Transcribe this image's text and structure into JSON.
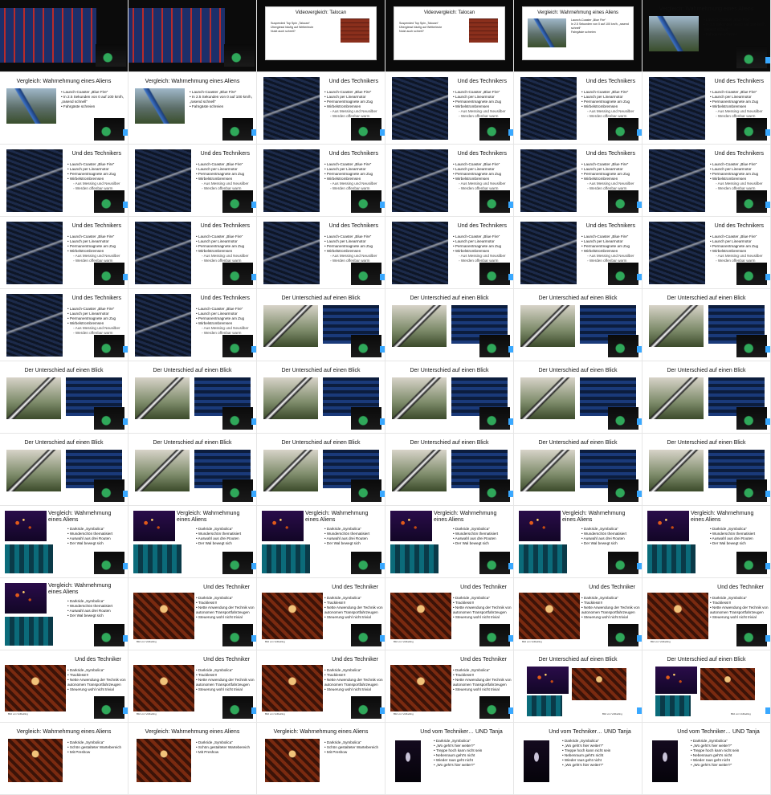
{
  "view": {
    "layout": "slide-sorter",
    "columns": 6,
    "rows": 11
  },
  "slides": [
    {
      "template": "photo-trains",
      "dark": true
    },
    {
      "template": "photo-trains",
      "dark": true
    },
    {
      "template": "video-talocan",
      "title": "Videovergleich: Talocan",
      "bullets": [
        "Suspended Top Spin „Talocan“",
        "Übergiesst häufig auf Wetterleute",
        "Nutzt auch schreit?"
      ]
    },
    {
      "template": "video-talocan",
      "title": "Videovergleich: Talocan",
      "bullets": [
        "Suspended Top Spin „Talocan“",
        "Übergiesst häufig auf Wetterleute",
        "Nutzt auch schreit?"
      ]
    },
    {
      "template": "vergleich-panel",
      "title": "Vergleich: Wahrnehmung eines Aliens",
      "bullets": [
        "Launch-Coaster „Blue Fire“",
        "In 2.5 Sekunden von 0 auf 100 km/h, „rasend schnell“",
        "Fahrgäste schreien"
      ]
    },
    {
      "template": "vergleich-coaster",
      "dark": true,
      "title": "Vergleich: Wahrnehmung eines Aliens",
      "bullets": [
        "Launch-Coaster „Blue Fire“",
        "In 2.5 Sekunden von 0 auf 100 km/h, „rasend schnell“",
        "Fahrgäste schreien"
      ]
    },
    {
      "template": "vergleich-coaster",
      "title": "Vergleich: Wahrnehmung eines Aliens",
      "bullets": [
        "Launch-Coaster „Blue Fire“",
        "In 2.5 Sekunden von 0 auf 100 km/h, „rasend schnell“",
        "Fahrgäste schreien"
      ]
    },
    {
      "template": "vergleich-coaster",
      "title": "Vergleich: Wahrnehmung eines Aliens",
      "bullets": [
        "Launch-Coaster „Blue Fire“",
        "In 2.5 Sekunden von 0 auf 100 km/h, „rasend schnell“",
        "Fahrgäste schreien"
      ]
    },
    {
      "template": "techniker",
      "title": "Und des Technikers",
      "bullets": [
        "Launch-Coaster „Blue Fire“",
        "Launch per Linearmotor",
        "Permanentmagnete am Zug",
        "Wirbelstrombremsen"
      ],
      "subs": [
        "Aus Messing und Neusilber",
        "Werden offenbar warm"
      ]
    },
    {
      "template": "techniker",
      "title": "Und des Technikers",
      "bullets": [
        "Launch-Coaster „Blue Fire“",
        "Launch per Linearmotor",
        "Permanentmagnete am Zug",
        "Wirbelstrombremsen"
      ],
      "subs": [
        "Aus Messing und Neusilber",
        "Werden offenbar warm"
      ]
    },
    {
      "template": "techniker",
      "title": "Und des Technikers",
      "bullets": [
        "Launch-Coaster „Blue Fire“",
        "Launch per Linearmotor",
        "Permanentmagnete am Zug",
        "Wirbelstrombremsen"
      ],
      "subs": [
        "Aus Messing und Neusilber",
        "Werden offenbar warm"
      ]
    },
    {
      "template": "techniker",
      "title": "Und des Technikers",
      "bullets": [
        "Launch-Coaster „Blue Fire“",
        "Launch per Linearmotor",
        "Permanentmagnete am Zug",
        "Wirbelstrombremsen"
      ],
      "subs": [
        "Aus Messing und Neusilber",
        "Werden offenbar warm"
      ]
    },
    {
      "template": "techniker",
      "title": "Und des Technikers",
      "bullets": [
        "Launch-Coaster „Blue Fire“",
        "Launch per Linearmotor",
        "Permanentmagnete am Zug",
        "Wirbelstrombremsen"
      ],
      "subs": [
        "Aus Messing und Neusilber",
        "Werden offenbar warm"
      ]
    },
    {
      "template": "techniker",
      "title": "Und des Technikers",
      "bullets": [
        "Launch-Coaster „Blue Fire“",
        "Launch per Linearmotor",
        "Permanentmagnete am Zug",
        "Wirbelstrombremsen"
      ],
      "subs": [
        "Aus Messing und Neusilber",
        "Werden offenbar warm"
      ]
    },
    {
      "template": "techniker",
      "title": "Und des Technikers",
      "bullets": [
        "Launch-Coaster „Blue Fire“",
        "Launch per Linearmotor",
        "Permanentmagnete am Zug",
        "Wirbelstrombremsen"
      ],
      "subs": [
        "Aus Messing und Neusilber",
        "Werden offenbar warm"
      ]
    },
    {
      "template": "techniker",
      "title": "Und des Technikers",
      "bullets": [
        "Launch-Coaster „Blue Fire“",
        "Launch per Linearmotor",
        "Permanentmagnete am Zug",
        "Wirbelstrombremsen"
      ],
      "subs": [
        "Aus Messing und Neusilber",
        "Werden offenbar warm"
      ]
    },
    {
      "template": "techniker",
      "title": "Und des Technikers",
      "bullets": [
        "Launch-Coaster „Blue Fire“",
        "Launch per Linearmotor",
        "Permanentmagnete am Zug",
        "Wirbelstrombremsen"
      ],
      "subs": [
        "Aus Messing und Neusilber",
        "Werden offenbar warm"
      ]
    },
    {
      "template": "techniker",
      "title": "Und des Technikers",
      "bullets": [
        "Launch-Coaster „Blue Fire“",
        "Launch per Linearmotor",
        "Permanentmagnete am Zug",
        "Wirbelstrombremsen"
      ],
      "subs": [
        "Aus Messing und Neusilber",
        "Werden offenbar warm"
      ]
    },
    {
      "template": "techniker",
      "title": "Und des Technikers",
      "bullets": [
        "Launch-Coaster „Blue Fire“",
        "Launch per Linearmotor",
        "Permanentmagnete am Zug",
        "Wirbelstrombremsen"
      ],
      "subs": [
        "Aus Messing und Neusilber",
        "Werden offenbar warm"
      ]
    },
    {
      "template": "techniker",
      "title": "Und des Technikers",
      "bullets": [
        "Launch-Coaster „Blue Fire“",
        "Launch per Linearmotor",
        "Permanentmagnete am Zug",
        "Wirbelstrombremsen"
      ],
      "subs": [
        "Aus Messing und Neusilber",
        "Werden offenbar warm"
      ]
    },
    {
      "template": "techniker",
      "title": "Und des Technikers",
      "bullets": [
        "Launch-Coaster „Blue Fire“",
        "Launch per Linearmotor",
        "Permanentmagnete am Zug",
        "Wirbelstrombremsen"
      ],
      "subs": [
        "Aus Messing und Neusilber",
        "Werden offenbar warm"
      ]
    },
    {
      "template": "techniker",
      "title": "Und des Technikers",
      "bullets": [
        "Launch-Coaster „Blue Fire“",
        "Launch per Linearmotor",
        "Permanentmagnete am Zug",
        "Wirbelstrombremsen"
      ],
      "subs": [
        "Aus Messing und Neusilber",
        "Werden offenbar warm"
      ]
    },
    {
      "template": "techniker",
      "title": "Und des Technikers",
      "bullets": [
        "Launch-Coaster „Blue Fire“",
        "Launch per Linearmotor",
        "Permanentmagnete am Zug",
        "Wirbelstrombremsen"
      ],
      "subs": [
        "Aus Messing und Neusilber",
        "Werden offenbar warm"
      ]
    },
    {
      "template": "techniker",
      "title": "Und des Technikers",
      "bullets": [
        "Launch-Coaster „Blue Fire“",
        "Launch per Linearmotor",
        "Permanentmagnete am Zug",
        "Wirbelstrombremsen"
      ],
      "subs": [
        "Aus Messing und Neusilber",
        "Werden offenbar warm"
      ]
    },
    {
      "template": "techniker",
      "title": "Und des Technikers",
      "bullets": [
        "Launch-Coaster „Blue Fire“",
        "Launch per Linearmotor",
        "Permanentmagnete am Zug",
        "Wirbelstrombremsen"
      ],
      "subs": [
        "Aus Messing und Neusilber",
        "Werden offenbar warm"
      ]
    },
    {
      "template": "techniker",
      "title": "Und des Technikers",
      "bullets": [
        "Launch-Coaster „Blue Fire“",
        "Launch per Linearmotor",
        "Permanentmagnete am Zug",
        "Wirbelstrombremsen"
      ],
      "subs": [
        "Aus Messing und Neusilber",
        "Werden offenbar warm"
      ]
    },
    {
      "template": "unterschied",
      "title": "Der Unterschied auf einen Blick"
    },
    {
      "template": "unterschied",
      "title": "Der Unterschied auf einen Blick"
    },
    {
      "template": "unterschied",
      "title": "Der Unterschied auf einen Blick"
    },
    {
      "template": "unterschied",
      "title": "Der Unterschied auf einen Blick"
    },
    {
      "template": "unterschied",
      "title": "Der Unterschied auf einen Blick"
    },
    {
      "template": "unterschied",
      "title": "Der Unterschied auf einen Blick"
    },
    {
      "template": "unterschied",
      "title": "Der Unterschied auf einen Blick"
    },
    {
      "template": "unterschied",
      "title": "Der Unterschied auf einen Blick"
    },
    {
      "template": "unterschied",
      "title": "Der Unterschied auf einen Blick"
    },
    {
      "template": "unterschied",
      "title": "Der Unterschied auf einen Blick"
    },
    {
      "template": "unterschied",
      "title": "Der Unterschied auf einen Blick"
    },
    {
      "template": "unterschied",
      "title": "Der Unterschied auf einen Blick"
    },
    {
      "template": "unterschied",
      "title": "Der Unterschied auf einen Blick"
    },
    {
      "template": "unterschied",
      "title": "Der Unterschied auf einen Blick"
    },
    {
      "template": "unterschied",
      "title": "Der Unterschied auf einen Blick"
    },
    {
      "template": "unterschied",
      "title": "Der Unterschied auf einen Blick"
    },
    {
      "template": "alien",
      "title": "Vergleich: Wahrnehmung eines Aliens",
      "bullets": [
        "Darkride „Symbolica“",
        "Wunderschön thematisiert",
        "Auswahl aus drei Routen",
        "Der Wal bewegt sich"
      ]
    },
    {
      "template": "alien",
      "title": "Vergleich: Wahrnehmung eines Aliens",
      "bullets": [
        "Darkride „Symbolica“",
        "Wunderschön thematisiert",
        "Auswahl aus drei Routen",
        "Der Wal bewegt sich"
      ]
    },
    {
      "template": "alien",
      "title": "Vergleich: Wahrnehmung eines Aliens",
      "bullets": [
        "Darkride „Symbolica“",
        "Wunderschön thematisiert",
        "Auswahl aus drei Routen",
        "Der Wal bewegt sich"
      ]
    },
    {
      "template": "alien",
      "title": "Vergleich: Wahrnehmung eines Aliens",
      "bullets": [
        "Darkride „Symbolica“",
        "Wunderschön thematisiert",
        "Auswahl aus drei Routen",
        "Der Wal bewegt sich"
      ]
    },
    {
      "template": "alien",
      "title": "Vergleich: Wahrnehmung eines Aliens",
      "bullets": [
        "Darkride „Symbolica“",
        "Wunderschön thematisiert",
        "Auswahl aus drei Routen",
        "Der Wal bewegt sich"
      ]
    },
    {
      "template": "alien",
      "title": "Vergleich: Wahrnehmung eines Aliens",
      "bullets": [
        "Darkride „Symbolica“",
        "Wunderschön thematisiert",
        "Auswahl aus drei Routen",
        "Der Wal bewegt sich"
      ]
    },
    {
      "template": "alien",
      "title": "Vergleich: Wahrnehmung eines Aliens",
      "bullets": [
        "Darkride „Symbolica“",
        "Wunderschön thematisiert",
        "Auswahl aus drei Routen",
        "Der Wal bewegt sich"
      ]
    },
    {
      "template": "techniker2",
      "title": "Und des Techniker",
      "bullets": [
        "Darkride „Symbolica“",
        "Trackless!!!",
        "Nette Anwendung der Technik von autonomen Transportfahrzeugen",
        "Steuerung wohl nicht trivial"
      ],
      "footer": "Bild von Vollkelling"
    },
    {
      "template": "techniker2",
      "title": "Und des Techniker",
      "bullets": [
        "Darkride „Symbolica“",
        "Trackless!!!",
        "Nette Anwendung der Technik von autonomen Transportfahrzeugen",
        "Steuerung wohl nicht trivial"
      ],
      "footer": "Bild von Vollkelling"
    },
    {
      "template": "techniker2",
      "title": "Und des Techniker",
      "bullets": [
        "Darkride „Symbolica“",
        "Trackless!!!",
        "Nette Anwendung der Technik von autonomen Transportfahrzeugen",
        "Steuerung wohl nicht trivial"
      ],
      "footer": "Bild von Vollkelling"
    },
    {
      "template": "techniker2",
      "title": "Und des Techniker",
      "bullets": [
        "Darkride „Symbolica“",
        "Trackless!!!",
        "Nette Anwendung der Technik von autonomen Transportfahrzeugen",
        "Steuerung wohl nicht trivial"
      ],
      "footer": "Bild von Vollkelling"
    },
    {
      "template": "techniker2",
      "title": "Und des Techniker",
      "bullets": [
        "Darkride „Symbolica“",
        "Trackless!!!",
        "Nette Anwendung der Technik von autonomen Transportfahrzeugen",
        "Steuerung wohl nicht trivial"
      ],
      "footer": "Bild von Vollkelling"
    },
    {
      "template": "techniker2",
      "title": "Und des Techniker",
      "bullets": [
        "Darkride „Symbolica“",
        "Trackless!!!",
        "Nette Anwendung der Technik von autonomen Transportfahrzeugen",
        "Steuerung wohl nicht trivial"
      ],
      "footer": "Bild von Vollkelling"
    },
    {
      "template": "techniker2",
      "title": "Und des Techniker",
      "bullets": [
        "Darkride „Symbolica“",
        "Trackless!!!",
        "Nette Anwendung der Technik von autonomen Transportfahrzeugen",
        "Steuerung wohl nicht trivial"
      ],
      "footer": "Bild von Vollkelling"
    },
    {
      "template": "techniker2",
      "title": "Und des Techniker",
      "bullets": [
        "Darkride „Symbolica“",
        "Trackless!!!",
        "Nette Anwendung der Technik von autonomen Transportfahrzeugen",
        "Steuerung wohl nicht trivial"
      ],
      "footer": "Bild von Vollkelling"
    },
    {
      "template": "techniker2",
      "title": "Und des Techniker",
      "bullets": [
        "Darkride „Symbolica“",
        "Trackless!!!",
        "Nette Anwendung der Technik von autonomen Transportfahrzeugen",
        "Steuerung wohl nicht trivial"
      ],
      "footer": "Bild von Vollkelling"
    },
    {
      "template": "unterschied2",
      "title": "Der Unterschied auf einen Blick",
      "footer": "Bild von Vollkelling"
    },
    {
      "template": "unterschied2",
      "title": "Der Unterschied auf einen Blick",
      "footer": "Bild von Vollkelling"
    },
    {
      "template": "preshow",
      "title": "Vergleich: Wahrnehmung eines Aliens",
      "bullets": [
        "Darkride „Symbolica“",
        "Schön gestalteter Wartebereich",
        "Mit Preshow"
      ]
    },
    {
      "template": "preshow",
      "title": "Vergleich: Wahrnehmung eines Aliens",
      "bullets": [
        "Darkride „Symbolica“",
        "Schön gestalteter Wartebereich",
        "Mit Preshow"
      ]
    },
    {
      "template": "preshow",
      "title": "Vergleich: Wahrnehmung eines Aliens",
      "bullets": [
        "Darkride „Symbolica“",
        "Schön gestalteter Wartebereich",
        "Mit Preshow"
      ]
    },
    {
      "template": "tanja",
      "title": "Und vom Techniker… UND Tanja",
      "bullets": [
        "Darkride „Symbolica“",
        "„Wo geht’s hier weiter?“",
        "Treppe hoch kann nicht sein",
        "Nebenraum geht’s nicht",
        "Wieder raus geht nicht",
        "„Wo geht’s hier weiter?“"
      ]
    },
    {
      "template": "tanja",
      "title": "Und vom Techniker… UND Tanja",
      "bullets": [
        "Darkride „Symbolica“",
        "„Wo geht’s hier weiter?“",
        "Treppe hoch kann nicht sein",
        "Nebenraum geht’s nicht",
        "Wieder raus geht nicht",
        "„Wo geht’s hier weiter?“"
      ]
    },
    {
      "template": "tanja",
      "title": "Und vom Techniker… UND Tanja",
      "bullets": [
        "Darkride „Symbolica“",
        "„Wo geht’s hier weiter?“",
        "Treppe hoch kann nicht sein",
        "Nebenraum geht’s nicht",
        "Wieder raus geht nicht",
        "„Wo geht’s hier weiter?“"
      ]
    }
  ]
}
